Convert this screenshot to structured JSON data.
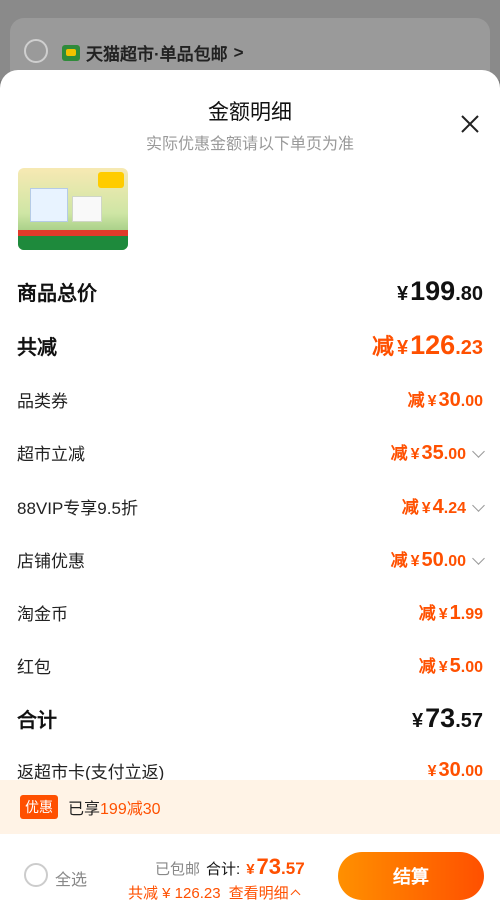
{
  "background": {
    "store_name": "天猫超市·单品包邮",
    "chevron": ">"
  },
  "sheet": {
    "title": "金额明细",
    "subtitle": "实际优惠金额请以下单页为准",
    "close_icon": "close-icon"
  },
  "rows": {
    "total_price": {
      "label": "商品总价",
      "currency": "¥",
      "int": "199",
      "dec": ".80"
    },
    "total_reduce": {
      "label": "共减",
      "prefix": "减",
      "currency": "¥",
      "int": "126",
      "dec": ".23"
    },
    "category_coupon": {
      "label": "品类券",
      "prefix": "减",
      "currency": "¥",
      "int": "30",
      "dec": ".00"
    },
    "market_discount": {
      "label": "超市立减",
      "prefix": "减",
      "currency": "¥",
      "int": "35",
      "dec": ".00"
    },
    "vip_discount": {
      "label": "88VIP专享9.5折",
      "prefix": "减",
      "currency": "¥",
      "int": "4",
      "dec": ".24"
    },
    "shop_discount": {
      "label": "店铺优惠",
      "prefix": "减",
      "currency": "¥",
      "int": "50",
      "dec": ".00"
    },
    "taojinbi": {
      "label": "淘金币",
      "prefix": "减",
      "currency": "¥",
      "int": "1",
      "dec": ".99"
    },
    "red_packet": {
      "label": "红包",
      "prefix": "减",
      "currency": "¥",
      "int": "5",
      "dec": ".00"
    },
    "subtotal": {
      "label": "合计",
      "currency": "¥",
      "int": "73",
      "dec": ".57"
    },
    "cashback": {
      "label": "返超市卡(支付立返)",
      "currency": "¥",
      "int": "30",
      "dec": ".00"
    }
  },
  "promo": {
    "badge": "优惠",
    "text_prefix": "已享",
    "text_highlight": "199减30"
  },
  "footer": {
    "select_all": "全选",
    "shipping": "已包邮",
    "total_label": "合计:",
    "total_currency": "¥",
    "total_int": "73",
    "total_dec": ".57",
    "reduce_text": "共减 ¥ 126.23",
    "detail_text": "查看明细",
    "checkout": "结算"
  },
  "colors": {
    "accent": "#ff5000",
    "promo_bg": "#fff3e6"
  }
}
